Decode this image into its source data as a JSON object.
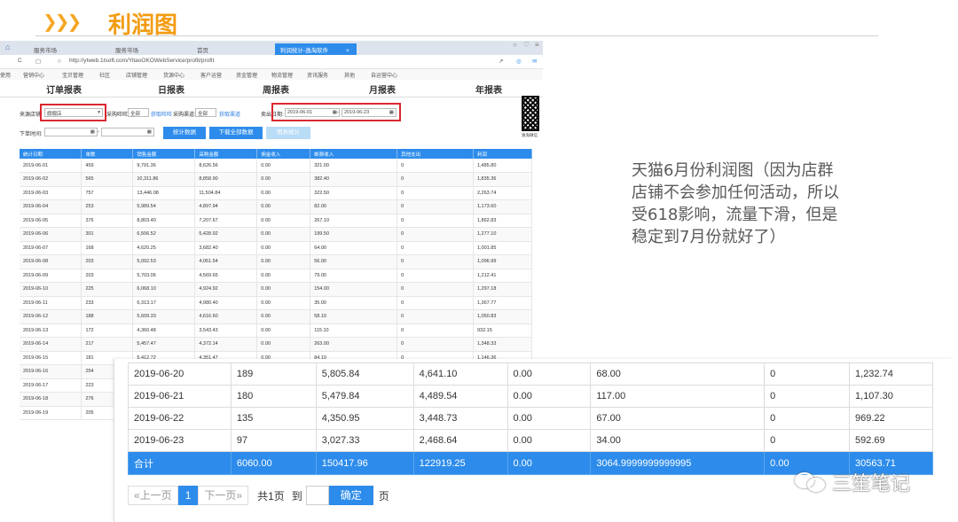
{
  "slide": {
    "arrows": "❯❯❯",
    "title": "利润图"
  },
  "browser": {
    "tabs": [
      "服务市场",
      "服务市场",
      "首页",
      "利润统计-逸淘软件"
    ],
    "tab_close": "×",
    "url": "http://ytweb.1tsoft.com/YitaoOKOWebService/profit/profit",
    "bookmarks": [
      "营销中心",
      "宝贝管理",
      "社区",
      "店铺管理",
      "货源中心",
      "客户运营",
      "资金管理",
      "物流管理",
      "资讯服务",
      "其他",
      "自运营中心"
    ],
    "left_cut": "使用"
  },
  "report_tabs": [
    "订单报表",
    "日报表",
    "周报表",
    "月报表",
    "年报表"
  ],
  "qr_caption": "逸淘微信",
  "filters": {
    "shop_label": "来源店铺:",
    "shop_value": "旗舰店",
    "buyer_label": "采购旺旺:",
    "buyer_value": "全部",
    "buyer_link": "获取旺旺",
    "channel_label": "采购渠道:",
    "channel_value": "全部",
    "channel_link": "获取渠道",
    "sell_date_label": "卖出日期:",
    "date_from": "2019-06-01",
    "date_to": "2019-06-23",
    "order_time_label": "下单时间:",
    "range_sep": "-",
    "btn_stats": "统计数据",
    "btn_download": "下载全部数据",
    "btn_chart": "图表统计"
  },
  "table1": {
    "headers": [
      "统计日期",
      "单数",
      "销售金额",
      "采购金额",
      "佣金收入",
      "邮费收入",
      "其他支出",
      "利润"
    ],
    "rows": [
      [
        "2019-06-01",
        "459",
        "9,791.36",
        "8,626.56",
        "0.00",
        "321.00",
        "0",
        "1,485.80"
      ],
      [
        "2019-06-02",
        "565",
        "10,311.86",
        "8,858.90",
        "0.00",
        "382.40",
        "0",
        "1,835.36"
      ],
      [
        "2019-06-03",
        "757",
        "13,446.08",
        "11,504.84",
        "0.00",
        "322.50",
        "0",
        "2,263.74"
      ],
      [
        "2019-06-04",
        "253",
        "5,989.54",
        "4,897.94",
        "0.00",
        "82.00",
        "0",
        "1,173.60"
      ],
      [
        "2019-06-05",
        "376",
        "8,803.40",
        "7,207.67",
        "0.00",
        "267.10",
        "0",
        "1,862.83"
      ],
      [
        "2019-06-06",
        "301",
        "6,506.52",
        "5,428.92",
        "0.00",
        "199.50",
        "0",
        "1,277.10"
      ],
      [
        "2019-06-07",
        "168",
        "4,620.25",
        "3,682.40",
        "0.00",
        "64.00",
        "0",
        "1,001.85"
      ],
      [
        "2019-06-08",
        "203",
        "5,092.53",
        "4,051.54",
        "0.00",
        "56.00",
        "0",
        "1,096.99"
      ],
      [
        "2019-06-09",
        "203",
        "5,703.06",
        "4,569.65",
        "0.00",
        "79.00",
        "0",
        "1,212.41"
      ],
      [
        "2019-06-10",
        "225",
        "6,068.10",
        "4,924.92",
        "0.00",
        "154.00",
        "0",
        "1,297.18"
      ],
      [
        "2019-06-11",
        "233",
        "6,313.17",
        "4,980.40",
        "0.00",
        "35.00",
        "0",
        "1,367.77"
      ],
      [
        "2019-06-12",
        "188",
        "5,609.33",
        "4,616.60",
        "0.00",
        "58.10",
        "0",
        "1,050.83"
      ],
      [
        "2019-06-13",
        "172",
        "4,360.48",
        "3,543.43",
        "0.00",
        "115.10",
        "0",
        "932.15"
      ],
      [
        "2019-06-14",
        "217",
        "5,457.47",
        "4,372.14",
        "0.00",
        "263.00",
        "0",
        "1,348.33"
      ],
      [
        "2019-06-15",
        "181",
        "5,412.72",
        "4,351.47",
        "0.00",
        "84.10",
        "0",
        "1,146.36"
      ],
      [
        "2019-06-16",
        "254",
        "",
        "",
        "",
        "",
        "",
        ""
      ],
      [
        "2019-06-17",
        "223",
        "",
        "",
        "",
        "",
        "",
        ""
      ],
      [
        "2019-06-18",
        "276",
        "",
        "",
        "",
        "",
        "",
        ""
      ],
      [
        "2019-06-19",
        "205",
        "",
        "",
        "",
        "",
        "",
        ""
      ]
    ]
  },
  "note": "天猫6月份利润图（因为店群店铺不会参加任何活动，所以受618影响，流量下滑，但是稳定到7月份就好了）",
  "table2": {
    "rows": [
      [
        "2019-06-20",
        "189",
        "5,805.84",
        "4,641.10",
        "0.00",
        "68.00",
        "0",
        "1,232.74"
      ],
      [
        "2019-06-21",
        "180",
        "5,479.84",
        "4,489.54",
        "0.00",
        "117.00",
        "0",
        "1,107.30"
      ],
      [
        "2019-06-22",
        "135",
        "4,350.95",
        "3,448.73",
        "0.00",
        "67.00",
        "0",
        "969.22"
      ],
      [
        "2019-06-23",
        "97",
        "3,027.33",
        "2,468.64",
        "0.00",
        "34.00",
        "0",
        "592.69"
      ]
    ],
    "total": [
      "合计",
      "6060.00",
      "150417.96",
      "122919.25",
      "0.00",
      "3064.9999999999995",
      "0.00",
      "30563.71"
    ]
  },
  "pager": {
    "prev": "«上一页",
    "current": "1",
    "next": "下一页»",
    "total_text": "共1页",
    "goto_text": "到",
    "confirm": "确定",
    "page_unit": "页"
  },
  "watermark": {
    "text": "三笙笔记",
    "icon": "wechat-icon"
  }
}
